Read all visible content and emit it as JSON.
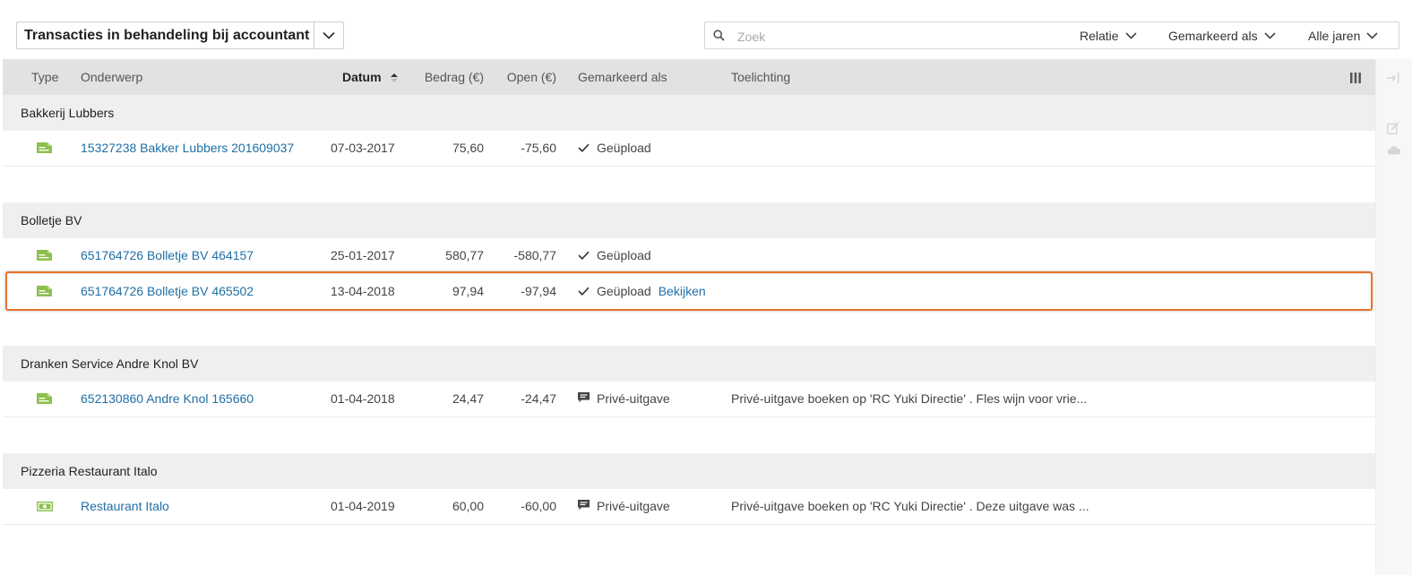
{
  "view_selector": {
    "label": "Transacties in behandeling bij accountant"
  },
  "search": {
    "placeholder": "Zoek",
    "value": ""
  },
  "filters": [
    {
      "label": "Relatie"
    },
    {
      "label": "Gemarkeerd als"
    },
    {
      "label": "Alle jaren"
    }
  ],
  "columns": {
    "type": "Type",
    "subject": "Onderwerp",
    "date": "Datum",
    "amount": "Bedrag (€)",
    "open": "Open (€)",
    "marked": "Gemarkeerd als",
    "note": "Toelichting"
  },
  "groups": [
    {
      "name": "Bakkerij Lubbers",
      "rows": [
        {
          "icon": "invoice-icon",
          "subject": "15327238 Bakker Lubbers 201609037",
          "date": "07-03-2017",
          "amount": "75,60",
          "open": "-75,60",
          "marked_icon": "check-icon",
          "marked": "Geüpload",
          "action": "",
          "note": ""
        }
      ]
    },
    {
      "name": "Bolletje BV",
      "rows": [
        {
          "icon": "invoice-icon",
          "subject": "651764726 Bolletje BV 464157",
          "date": "25-01-2017",
          "amount": "580,77",
          "open": "-580,77",
          "marked_icon": "check-icon",
          "marked": "Geüpload",
          "action": "",
          "note": ""
        },
        {
          "icon": "invoice-icon",
          "subject": "651764726 Bolletje BV 465502",
          "date": "13-04-2018",
          "amount": "97,94",
          "open": "-97,94",
          "marked_icon": "check-icon",
          "marked": "Geüpload",
          "action": "Bekijken",
          "note": ""
        }
      ]
    },
    {
      "name": "Dranken Service Andre Knol BV",
      "rows": [
        {
          "icon": "invoice-icon",
          "subject": "652130860 Andre Knol 165660",
          "date": "01-04-2018",
          "amount": "24,47",
          "open": "-24,47",
          "marked_icon": "comment-icon",
          "marked": "Privé-uitgave",
          "action": "",
          "note": "Privé-uitgave boeken op 'RC Yuki Directie' . Fles wijn voor vrie..."
        }
      ]
    },
    {
      "name": "Pizzeria Restaurant Italo",
      "rows": [
        {
          "icon": "cash-icon",
          "subject": "Restaurant Italo",
          "date": "01-04-2019",
          "amount": "60,00",
          "open": "-60,00",
          "marked_icon": "comment-icon",
          "marked": "Privé-uitgave",
          "action": "",
          "note": "Privé-uitgave boeken op 'RC Yuki Directie' . Deze uitgave was ..."
        }
      ]
    }
  ],
  "colors": {
    "accent_link": "#1f6fa5",
    "icon_green": "#8cc04a",
    "highlight": "#e8732b",
    "header_bg": "#e2e2e2",
    "group_bg": "#efefef"
  }
}
